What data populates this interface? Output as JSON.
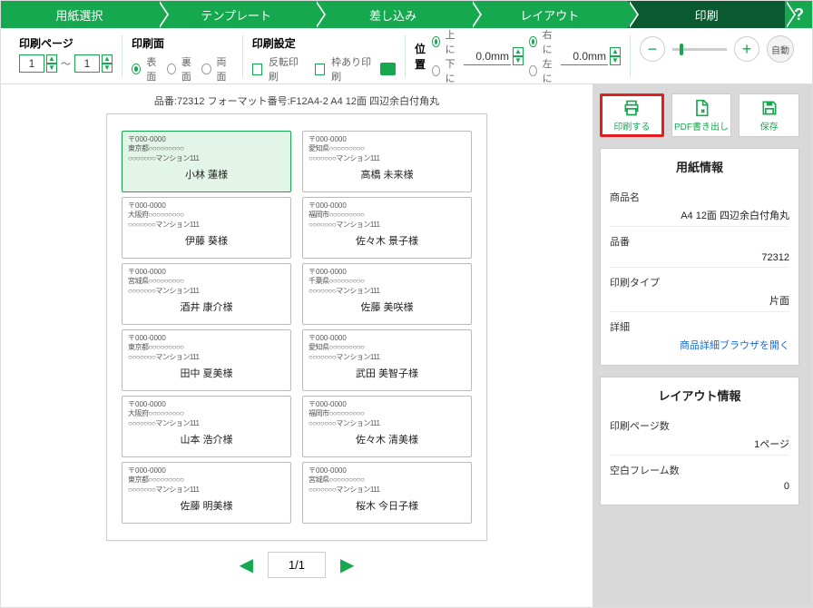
{
  "stepper": {
    "steps": [
      "用紙選択",
      "テンプレート",
      "差し込み",
      "レイアウト",
      "印刷"
    ],
    "help": "?"
  },
  "toolbar": {
    "page_range": {
      "label": "印刷ページ",
      "from": "1",
      "sep": "〜",
      "to": "1"
    },
    "side": {
      "label": "印刷面",
      "front": "表面",
      "back": "裏面",
      "both": "両面"
    },
    "print_settings": {
      "label": "印刷設定",
      "reverse": "反転印刷",
      "frame": "枠あり印刷"
    },
    "position": {
      "label": "位置",
      "up": "上に",
      "down": "下に",
      "right": "右に",
      "left": "左に",
      "v_val": "0.0mm",
      "h_val": "0.0mm"
    },
    "zoom": {
      "auto": "自動"
    }
  },
  "sheet": {
    "header": "品番:72312 フォーマット番号:F12A4-2 A4 12面 四辺余白付角丸",
    "labels": [
      {
        "zip": "〒000-0000",
        "addr1": "東京都○○○○○○○○○",
        "addr2": "○○○○○○○マンション111",
        "name": "小林 蓮様"
      },
      {
        "zip": "〒000-0000",
        "addr1": "愛知県○○○○○○○○○",
        "addr2": "○○○○○○○マンション111",
        "name": "高橋 未来様"
      },
      {
        "zip": "〒000-0000",
        "addr1": "大阪府○○○○○○○○○",
        "addr2": "○○○○○○○マンション111",
        "name": "伊藤 葵様"
      },
      {
        "zip": "〒000-0000",
        "addr1": "福岡市○○○○○○○○○",
        "addr2": "○○○○○○○マンション111",
        "name": "佐々木 景子様"
      },
      {
        "zip": "〒000-0000",
        "addr1": "宮城県○○○○○○○○○",
        "addr2": "○○○○○○○マンション111",
        "name": "酒井 康介様"
      },
      {
        "zip": "〒000-0000",
        "addr1": "千葉県○○○○○○○○○",
        "addr2": "○○○○○○○マンション111",
        "name": "佐藤 美咲様"
      },
      {
        "zip": "〒000-0000",
        "addr1": "東京都○○○○○○○○○",
        "addr2": "○○○○○○○マンション111",
        "name": "田中 夏美様"
      },
      {
        "zip": "〒000-0000",
        "addr1": "愛知県○○○○○○○○○",
        "addr2": "○○○○○○○マンション111",
        "name": "武田 美智子様"
      },
      {
        "zip": "〒000-0000",
        "addr1": "大阪府○○○○○○○○○",
        "addr2": "○○○○○○○マンション111",
        "name": "山本 浩介様"
      },
      {
        "zip": "〒000-0000",
        "addr1": "福岡市○○○○○○○○○",
        "addr2": "○○○○○○○マンション111",
        "name": "佐々木 清美様"
      },
      {
        "zip": "〒000-0000",
        "addr1": "東京都○○○○○○○○○",
        "addr2": "○○○○○○○マンション111",
        "name": "佐藤 明美様"
      },
      {
        "zip": "〒000-0000",
        "addr1": "宮城県○○○○○○○○○",
        "addr2": "○○○○○○○マンション111",
        "name": "桜木 今日子様"
      }
    ],
    "pager": "1/1"
  },
  "side": {
    "actions": {
      "print": "印刷する",
      "pdf": "PDF書き出し",
      "save": "保存"
    },
    "paper_info": {
      "title": "用紙情報",
      "name_k": "商品名",
      "name_v": "A4 12面 四辺余白付角丸",
      "code_k": "品番",
      "code_v": "72312",
      "type_k": "印刷タイプ",
      "type_v": "片面",
      "detail_k": "詳細",
      "detail_link": "商品詳細ブラウザを開く"
    },
    "layout_info": {
      "title": "レイアウト情報",
      "pages_k": "印刷ページ数",
      "pages_v": "1ページ",
      "empty_k": "空白フレーム数",
      "empty_v": "0"
    }
  }
}
